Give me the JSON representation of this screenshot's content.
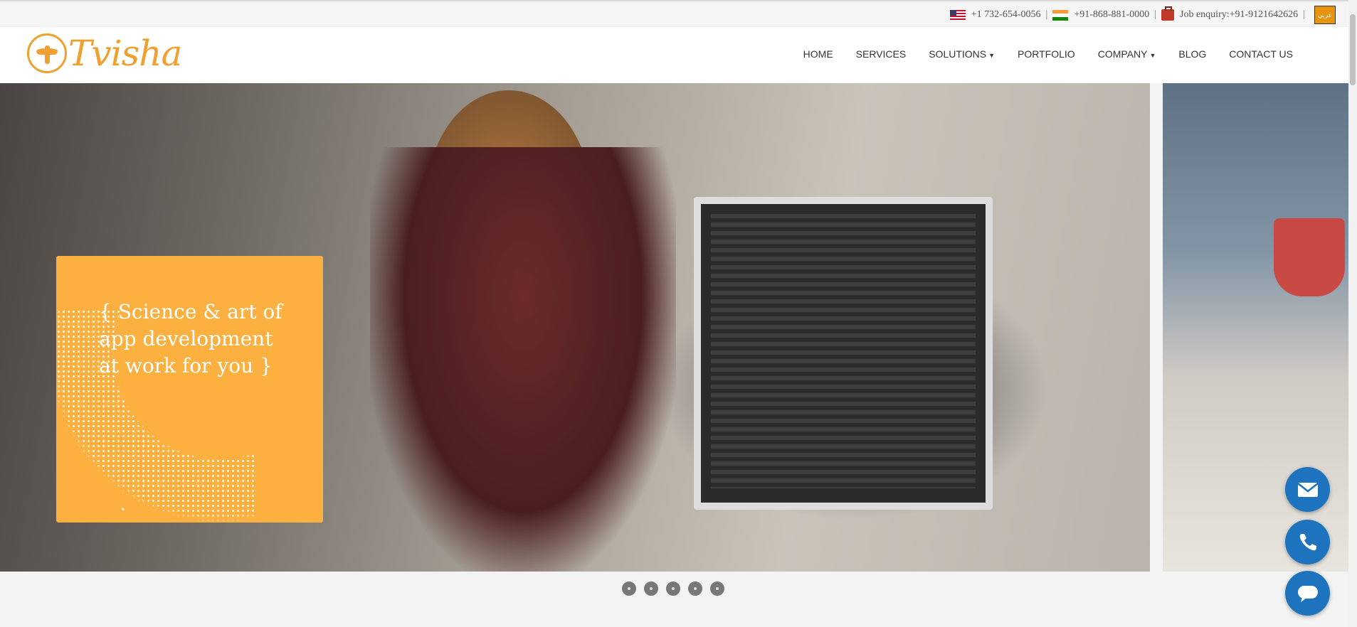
{
  "topbar": {
    "us_phone": "+1 732-654-0056",
    "in_phone": "+91-868-881-0000",
    "job_enquiry": "Job enquiry:+91-9121642626",
    "separator": "|",
    "lang_button": "عربي"
  },
  "logo": {
    "text": "Tvisha"
  },
  "nav": {
    "items": [
      {
        "label": "HOME"
      },
      {
        "label": "SERVICES"
      },
      {
        "label": "SOLUTIONS",
        "dropdown": true
      },
      {
        "label": "PORTFOLIO"
      },
      {
        "label": "COMPANY",
        "dropdown": true
      },
      {
        "label": "BLOG"
      },
      {
        "label": "CONTACT US"
      }
    ]
  },
  "hero": {
    "card_line1": "{ Science & art of",
    "card_line2": "app development",
    "card_line3": "at work for you }",
    "slide_count": 5
  },
  "fabs": {
    "email": "mail-icon",
    "phone": "phone-icon",
    "chat": "chat-icon",
    "color": "#1e73be"
  },
  "colors": {
    "brand_orange": "#f0a030",
    "card_orange": "#fbb040"
  }
}
